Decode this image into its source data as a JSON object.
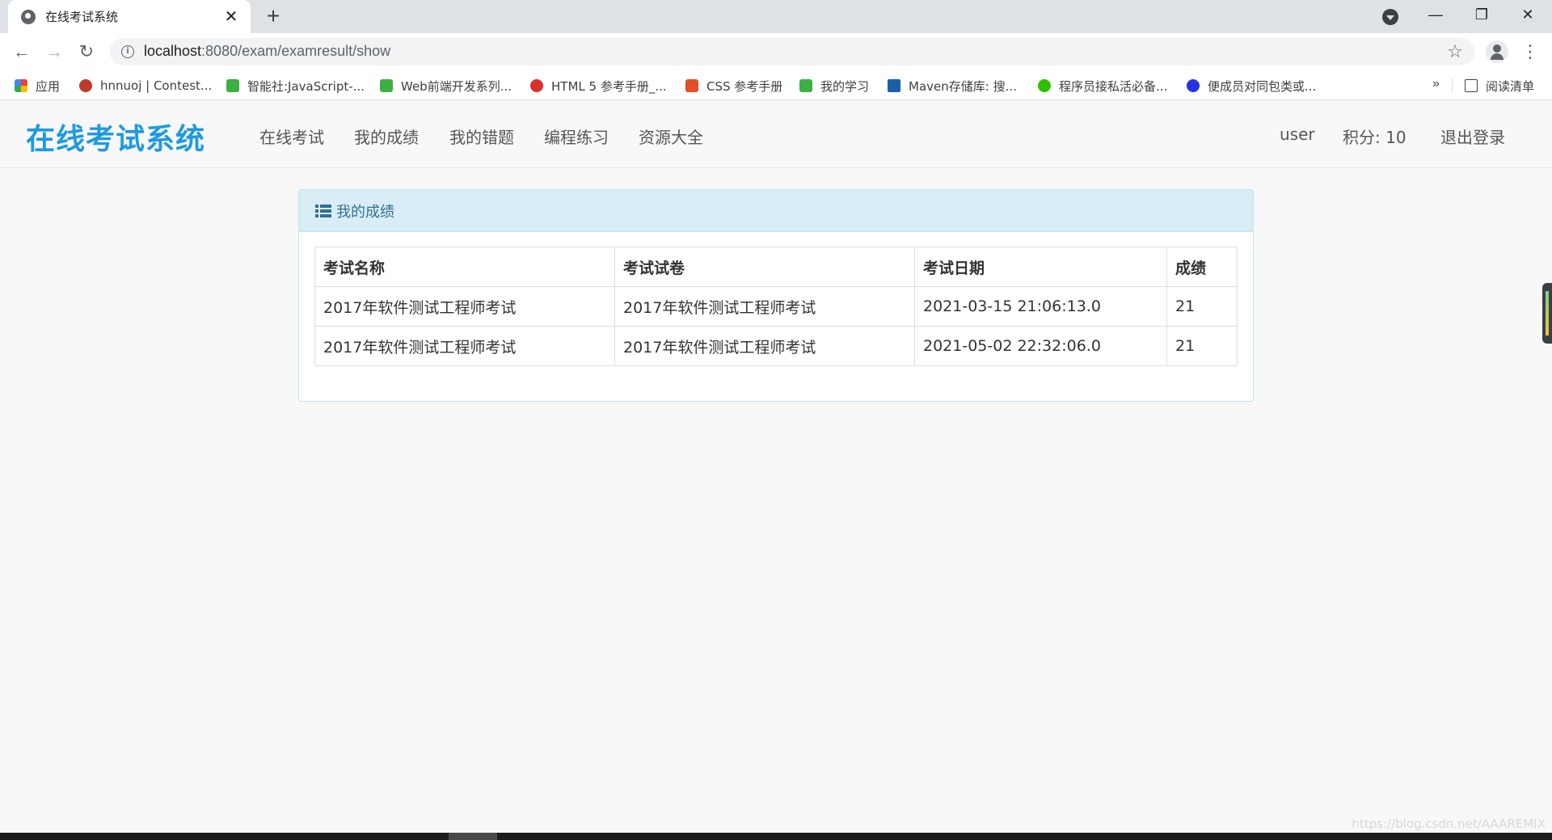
{
  "browser": {
    "tab_title": "在线考试系统",
    "tab_close": "✕",
    "new_tab": "+",
    "window_controls": {
      "minimize": "—",
      "maximize": "❐",
      "close": "✕"
    },
    "url_host": "localhost",
    "url_rest": ":8080/exam/examresult/show",
    "star": "☆",
    "menu": "⋮",
    "bookmarks": [
      {
        "label": "应用",
        "icon": "apps-grid-icon",
        "color": "#ea4335"
      },
      {
        "label": "hnnuoj | Contest...",
        "icon": "balloon-icon",
        "color": "#c0392b"
      },
      {
        "label": "智能社:JavaScript-...",
        "icon": "green-book-icon",
        "color": "#3cb043"
      },
      {
        "label": "Web前端开发系列...",
        "icon": "green-book-icon",
        "color": "#3cb043"
      },
      {
        "label": "HTML 5 参考手册_...",
        "icon": "owl-icon",
        "color": "#d9322b"
      },
      {
        "label": "CSS 参考手册",
        "icon": "css-shield-icon",
        "color": "#e44d26"
      },
      {
        "label": "我的学习",
        "icon": "green-book-icon",
        "color": "#3cb043"
      },
      {
        "label": "Maven存储库: 搜...",
        "icon": "mvn-icon",
        "color": "#1a5fa8"
      },
      {
        "label": "程序员接私活必备...",
        "icon": "wechat-icon",
        "color": "#2dc100"
      },
      {
        "label": "便成员对同包类或...",
        "icon": "baidu-paw-icon",
        "color": "#2932e1"
      }
    ],
    "bookmarks_more": "»",
    "reading_list": "阅读清单"
  },
  "site": {
    "brand": "在线考试系统",
    "nav": [
      "在线考试",
      "我的成绩",
      "我的错题",
      "编程练习",
      "资源大全"
    ],
    "user": "user",
    "points": "积分: 10",
    "logout": "退出登录"
  },
  "panel": {
    "title": "我的成绩",
    "columns": [
      "考试名称",
      "考试试卷",
      "考试日期",
      "成绩"
    ],
    "rows": [
      [
        "2017年软件测试工程师考试",
        "2017年软件测试工程师考试",
        "2021-03-15 21:06:13.0",
        "21"
      ],
      [
        "2017年软件测试工程师考试",
        "2017年软件测试工程师考试",
        "2021-05-02 22:32:06.0",
        "21"
      ]
    ]
  },
  "watermark": "https://blog.csdn.net/AAAREMIX",
  "colors": {
    "brand": "#1e9ae0",
    "panel_heading_bg": "#d9edf7",
    "panel_heading_text": "#31708f",
    "panel_border": "#bce8f1"
  }
}
